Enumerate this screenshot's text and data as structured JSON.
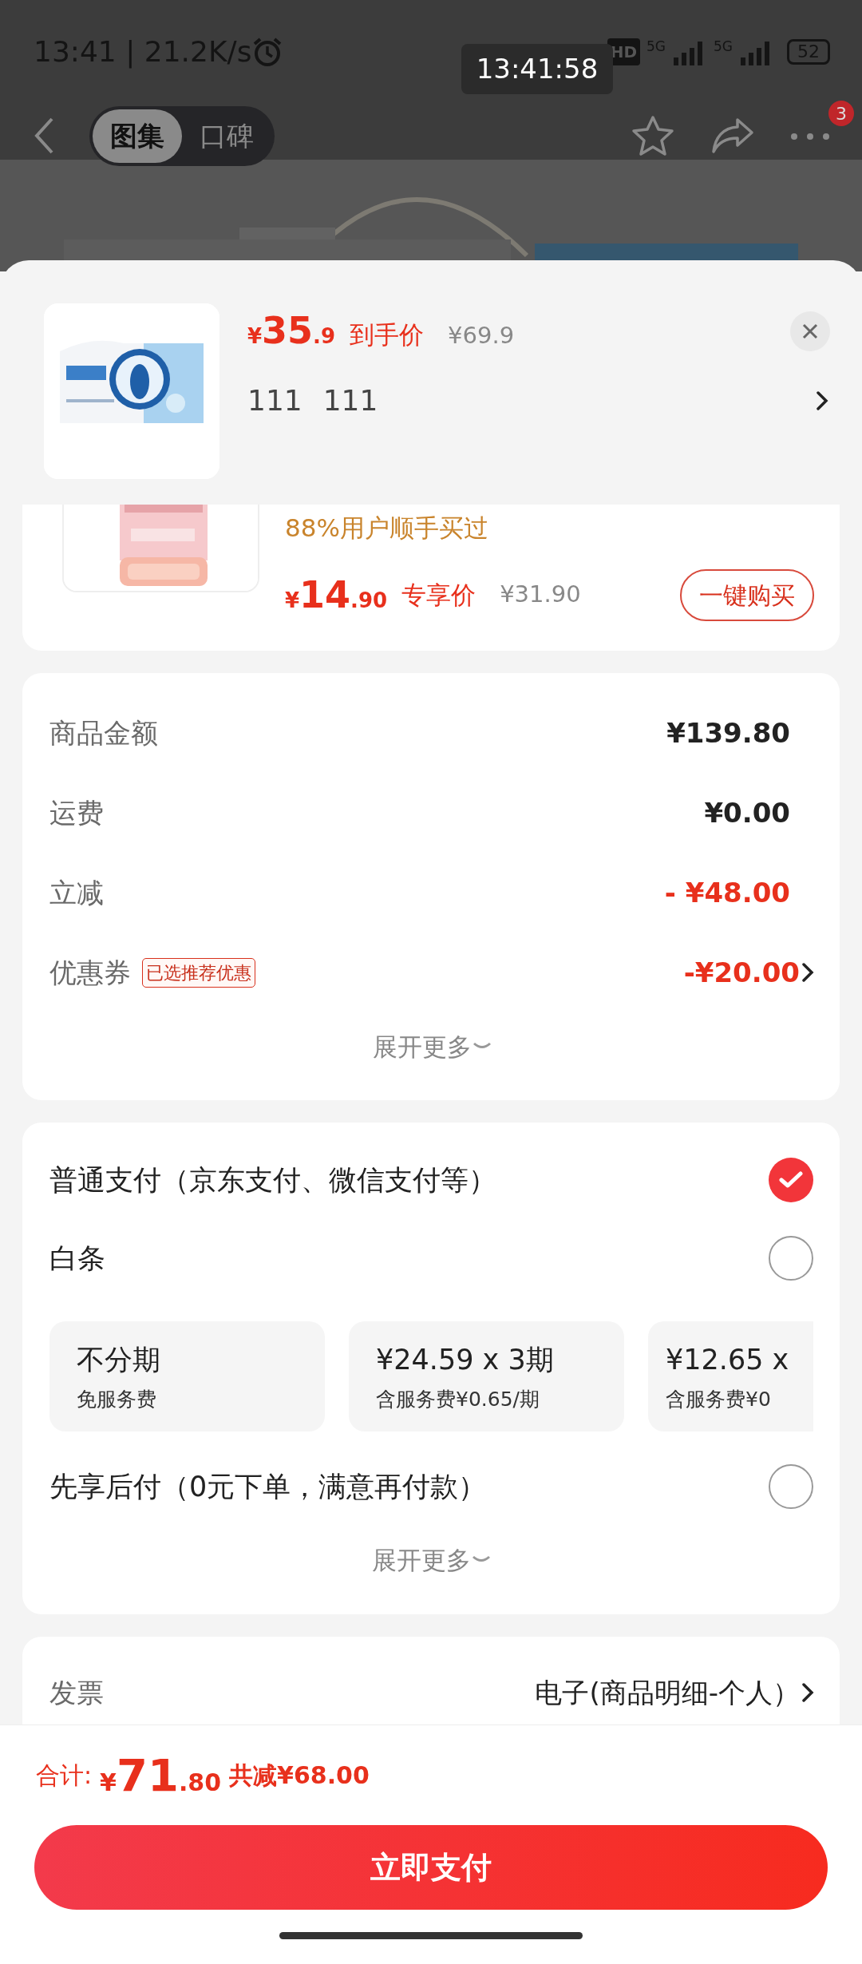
{
  "status_bar": {
    "time": "13:41 | 21.2K/s",
    "hd": "HD",
    "networks": [
      "5G",
      "5G"
    ],
    "battery": "52"
  },
  "screenshot_time": "13:41:58",
  "nav": {
    "tabs": [
      {
        "label": "图集",
        "selected": true
      },
      {
        "label": "口碑",
        "selected": false
      }
    ],
    "badge": "3"
  },
  "product": {
    "price": {
      "symbol": "¥",
      "whole": "35",
      "fraction": ".9"
    },
    "price_label": "到手价",
    "original_price": "¥69.9",
    "spec": [
      "111",
      "111"
    ]
  },
  "addon": {
    "note": "88%用户顺手买过",
    "price": {
      "symbol": "¥",
      "whole": "14",
      "fraction": ".90"
    },
    "price_label": "专享价",
    "original_price": "¥31.90",
    "button": "一键购买"
  },
  "summary": {
    "rows": [
      {
        "label": "商品金额",
        "value": "¥139.80",
        "kind": "plain",
        "chevron": false
      },
      {
        "label": "运费",
        "value": "¥0.00",
        "kind": "plain",
        "chevron": false
      },
      {
        "label": "立减",
        "value": "- ¥48.00",
        "kind": "discount",
        "chevron": false
      },
      {
        "label": "优惠券",
        "tag": "已选推荐优惠",
        "value": "-¥20.00",
        "kind": "discount",
        "chevron": true
      }
    ],
    "more": "展开更多"
  },
  "payment": {
    "options": [
      {
        "label": "普通支付（京东支付、微信支付等）",
        "selected": true
      },
      {
        "label": "白条",
        "selected": false,
        "plans": [
          {
            "title": "不分期",
            "note": "免服务费"
          },
          {
            "title": "¥24.59 x 3期",
            "note": "含服务费¥0.65/期"
          },
          {
            "title": "¥12.65 x",
            "note": "含服务费¥0"
          }
        ]
      },
      {
        "label": "先享后付（0元下单，满意再付款）",
        "selected": false
      }
    ],
    "more": "展开更多"
  },
  "invoice": {
    "label": "发票",
    "value": "电子(商品明细-个人）"
  },
  "footer": {
    "total_label": "合计:",
    "total": {
      "symbol": "¥",
      "whole": "71",
      "fraction": ".80"
    },
    "saved": "共减¥68.00",
    "button": "立即支付"
  }
}
